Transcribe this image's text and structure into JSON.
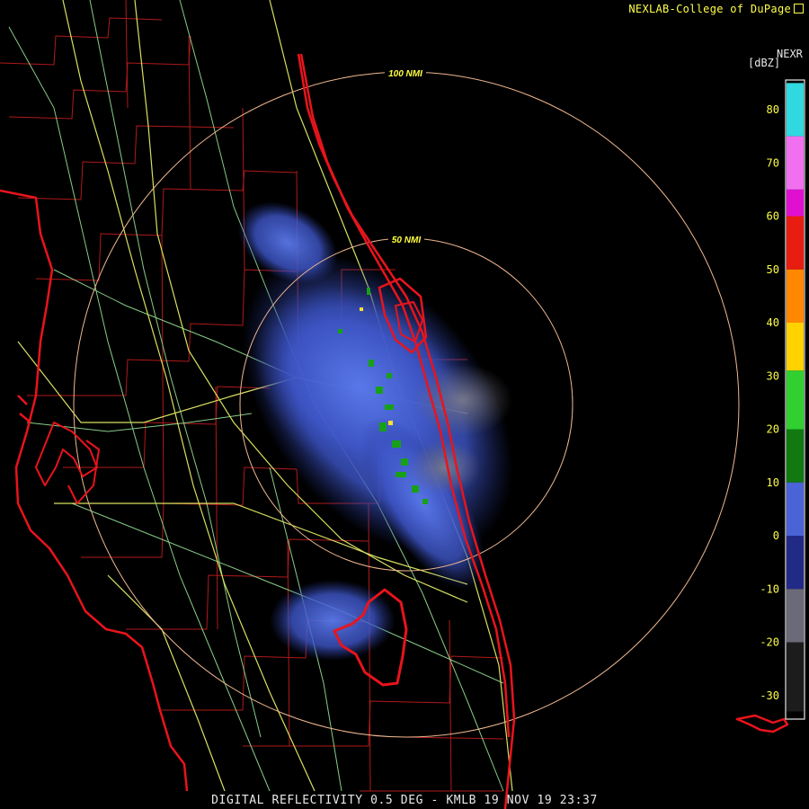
{
  "header": {
    "credit": "NEXLAB-College of DuPage"
  },
  "footer": {
    "caption": "DIGITAL REFLECTIVITY 0.5 DEG - KMLB 19 NOV 19 23:37"
  },
  "legend": {
    "source": "NEXR",
    "unit": "[dBZ]",
    "ticks": [
      "80",
      "70",
      "60",
      "50",
      "40",
      "30",
      "20",
      "10",
      "0",
      "-10",
      "-20",
      "-30"
    ],
    "scale": [
      {
        "from": 75,
        "to": 85,
        "color": "#30d8e0"
      },
      {
        "from": 65,
        "to": 75,
        "color": "#f070f0"
      },
      {
        "from": 60,
        "to": 65,
        "color": "#e010d0"
      },
      {
        "from": 50,
        "to": 60,
        "color": "#e81c10"
      },
      {
        "from": 40,
        "to": 50,
        "color": "#ff8800"
      },
      {
        "from": 31,
        "to": 40,
        "color": "#ffd200"
      },
      {
        "from": 20,
        "to": 31,
        "color": "#30d030"
      },
      {
        "from": 10,
        "to": 20,
        "color": "#107a10"
      },
      {
        "from": 0,
        "to": 10,
        "color": "#4a63d6"
      },
      {
        "from": -10,
        "to": 0,
        "color": "#222a88"
      },
      {
        "from": -20,
        "to": -10,
        "color": "#6a6a78"
      },
      {
        "from": -33,
        "to": -20,
        "color": "#1c1c1c"
      }
    ]
  },
  "range_rings": [
    {
      "label": "100 NMI"
    },
    {
      "label": "50 NMI"
    }
  ],
  "colors": {
    "coast": "#e8141c",
    "county": "#b01a1a",
    "highway": "#d8e060",
    "road": "#88cc88",
    "ring": "#f0b890",
    "ring_label": "#ffff40"
  }
}
